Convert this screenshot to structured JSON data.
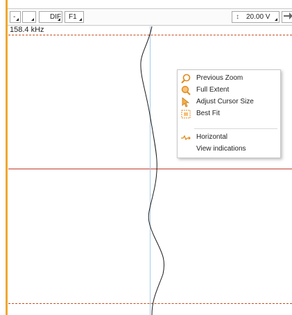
{
  "toolbar": {
    "btn1_label": "-",
    "btn2_label": "",
    "dif_label": "DIF",
    "f1_label": "F1",
    "voltage_label": "20.00 V",
    "voltage_icon": "vertical-arrows-icon",
    "next_icon": "arrow-right-icon"
  },
  "plot": {
    "frequency_label": "158.4 kHz",
    "accent_color": "#f0a830",
    "cursor_line_color": "#c0392b",
    "marker_line_color": "#c44a1a"
  },
  "context_menu": {
    "items": [
      {
        "label": "Previous Zoom",
        "icon": "magnifier-icon"
      },
      {
        "label": "Full Extent",
        "icon": "zoom-extent-icon"
      },
      {
        "label": "Adjust Cursor Size",
        "icon": "cursor-size-icon"
      },
      {
        "label": "Best Fit",
        "icon": "best-fit-icon"
      },
      {
        "label": "Horizontal",
        "icon": "horizontal-icon"
      },
      {
        "label": "View indications",
        "icon": ""
      }
    ]
  }
}
